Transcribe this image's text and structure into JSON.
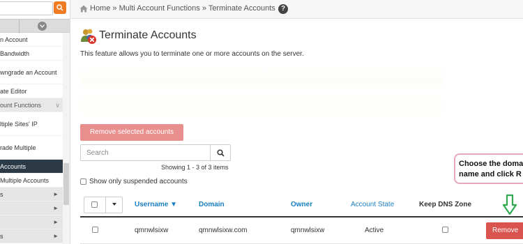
{
  "sidebar": {
    "search_icon": "search-icon",
    "collapse_icon": "chevron-down-icon",
    "items": [
      {
        "label": "n Account",
        "kind": "item"
      },
      {
        "label": "Bandwidth",
        "kind": "item"
      },
      {
        "label": "wngrade an Account",
        "kind": "item-tall"
      },
      {
        "label": "ate Editor",
        "kind": "item"
      },
      {
        "label": "ount Functions",
        "kind": "cat"
      },
      {
        "label": "ltiple Sites' IP",
        "kind": "item-tall"
      },
      {
        "label": "rade Multiple",
        "kind": "item-tall"
      },
      {
        "label": "Accounts",
        "kind": "active"
      },
      {
        "label": "Multiple Accounts",
        "kind": "sub"
      },
      {
        "label": "s",
        "kind": "group"
      },
      {
        "label": "",
        "kind": "group"
      },
      {
        "label": "",
        "kind": "group"
      },
      {
        "label": "s",
        "kind": "group"
      }
    ]
  },
  "breadcrumb": {
    "home": "Home",
    "sep": "»",
    "parent": "Multi Account Functions",
    "current": "Terminate Accounts",
    "help": "?"
  },
  "page": {
    "title": "Terminate Accounts",
    "description": "This feature allows you to terminate one or more accounts on the server."
  },
  "controls": {
    "remove_selected_label": "Remove selected accounts",
    "search_placeholder": "Search",
    "showing_text": "Showing 1 - 3 of 3 items",
    "show_suspended_label": "Show only suspended accounts"
  },
  "table": {
    "headers": {
      "username": "Username ▼",
      "domain": "Domain",
      "owner": "Owner",
      "account_state": "Account State",
      "keep_dns": "Keep DNS Zone"
    },
    "rows": [
      {
        "username": "qmnwlsixw",
        "domain": "qmnwlsixw.com",
        "owner": "qmnwlsixw",
        "state": "Active",
        "action": "Remove"
      }
    ]
  },
  "callout": {
    "line1": "Choose the doma",
    "line2": "name and click R"
  },
  "colors": {
    "accent_orange": "#f07b23",
    "link_blue": "#1a7fc1",
    "danger_red": "#d9534f",
    "danger_disabled": "#e98f8d",
    "sidebar_active": "#2c3a46",
    "arrow_green": "#2fa84f",
    "callout_border": "#e6a6c1"
  }
}
